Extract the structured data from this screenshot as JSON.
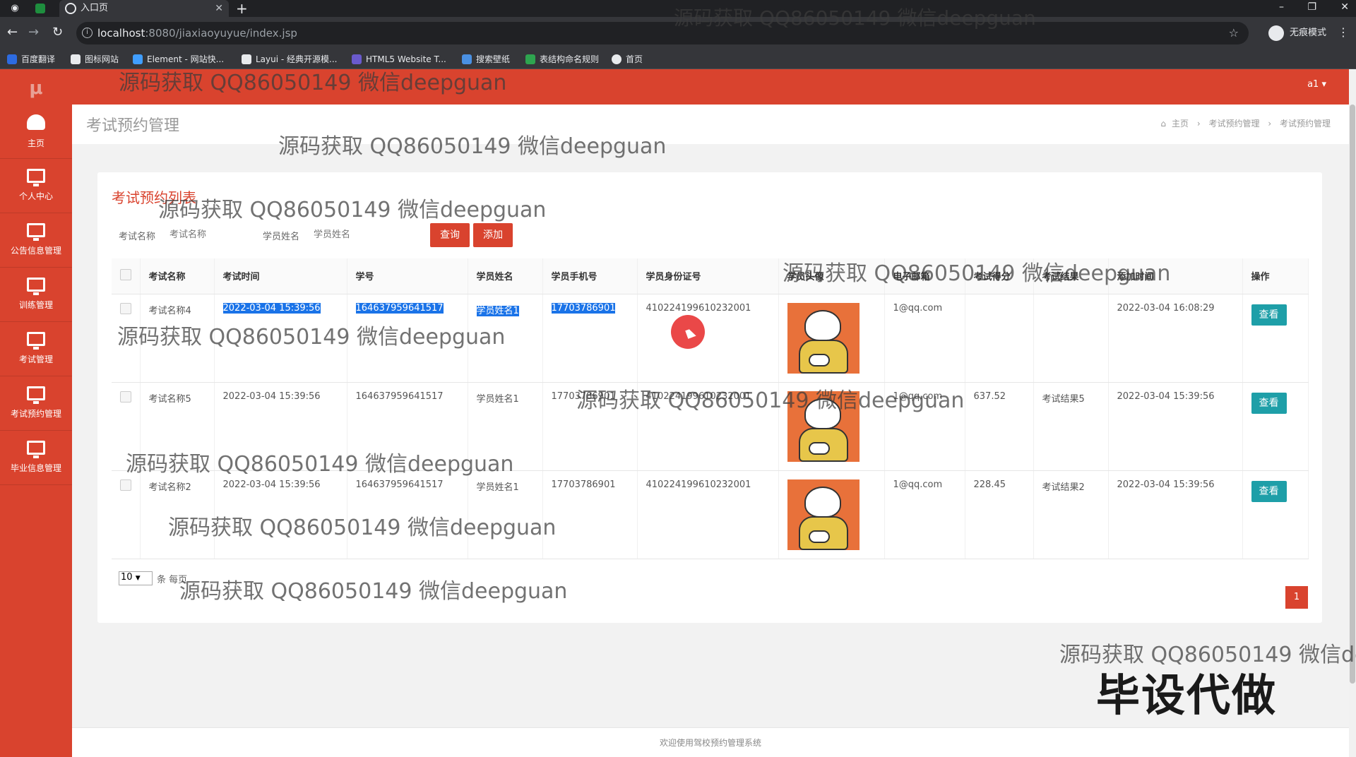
{
  "browser": {
    "tab_title": "入口页",
    "url_host": "localhost",
    "url_rest": ":8080/jiaxiaoyuyue/index.jsp",
    "profile_label": "无痕模式",
    "bookmarks": [
      {
        "label": "百度翻译",
        "color": "#2d6be0"
      },
      {
        "label": "图标网站",
        "color": "#e8eaed"
      },
      {
        "label": "Element - 网站快...",
        "color": "#409eff"
      },
      {
        "label": "Layui - 经典开源模...",
        "color": "#e8eaed"
      },
      {
        "label": "HTML5 Website T...",
        "color": "#6a5acd"
      },
      {
        "label": "搜索壁纸",
        "color": "#4a90e2"
      },
      {
        "label": "表结构命名规则",
        "color": "#2ea44f"
      },
      {
        "label": "首页",
        "color": "#e8eaed"
      }
    ]
  },
  "app": {
    "logo": "μ",
    "user_menu": "a1 ▾",
    "accent": "#d9432e",
    "sidebar": [
      {
        "label": "主页",
        "icon": "dashboard-icon"
      },
      {
        "label": "个人中心",
        "icon": "monitor-icon"
      },
      {
        "label": "公告信息管理",
        "icon": "monitor-icon"
      },
      {
        "label": "训练管理",
        "icon": "monitor-icon"
      },
      {
        "label": "考试管理",
        "icon": "monitor-icon"
      },
      {
        "label": "考试预约管理",
        "icon": "monitor-icon"
      },
      {
        "label": "毕业信息管理",
        "icon": "monitor-icon"
      }
    ],
    "page_title": "考试预约管理",
    "breadcrumb": {
      "home": "主页",
      "level1": "考试预约管理",
      "level2": "考试预约管理"
    }
  },
  "list": {
    "title": "考试预约列表",
    "search": [
      {
        "label": "考试名称",
        "placeholder": "考试名称"
      },
      {
        "label": "学员姓名",
        "placeholder": "学员姓名"
      }
    ],
    "query_button": "查询",
    "add_button": "添加",
    "columns": [
      "考试名称",
      "考试时间",
      "学号",
      "学员姓名",
      "学员手机号",
      "学员身份证号",
      "学员头像",
      "电子邮箱",
      "考试得分",
      "考试结果",
      "添加时间",
      "操作"
    ],
    "rows": [
      {
        "exam": "考试名称4",
        "time": "2022-03-04 15:39:56",
        "sno": "164637959641517",
        "name": "学员姓名1",
        "phone": "17703786901",
        "idcard": "410224199610232001",
        "email": "1@qq.com",
        "score": "",
        "result": "",
        "added": "2022-03-04 16:08:29",
        "action": "查看"
      },
      {
        "exam": "考试名称5",
        "time": "2022-03-04 15:39:56",
        "sno": "164637959641517",
        "name": "学员姓名1",
        "phone": "17703786901",
        "idcard": "410224199610232001",
        "email": "1@qq.com",
        "score": "637.52",
        "result": "考试结果5",
        "added": "2022-03-04 15:39:56",
        "action": "查看"
      },
      {
        "exam": "考试名称2",
        "time": "2022-03-04 15:39:56",
        "sno": "164637959641517",
        "name": "学员姓名1",
        "phone": "17703786901",
        "idcard": "410224199610232001",
        "email": "1@qq.com",
        "score": "228.45",
        "result": "考试结果2",
        "added": "2022-03-04 15:39:56",
        "action": "查看"
      }
    ],
    "page_size": "10",
    "page_size_label": "条 每页",
    "current_page": "1"
  },
  "footer": "欢迎使用驾校预约管理系统",
  "overlay": {
    "watermark": "源码获取 QQ86050149 微信deepguan",
    "stamp": "毕设代做"
  }
}
